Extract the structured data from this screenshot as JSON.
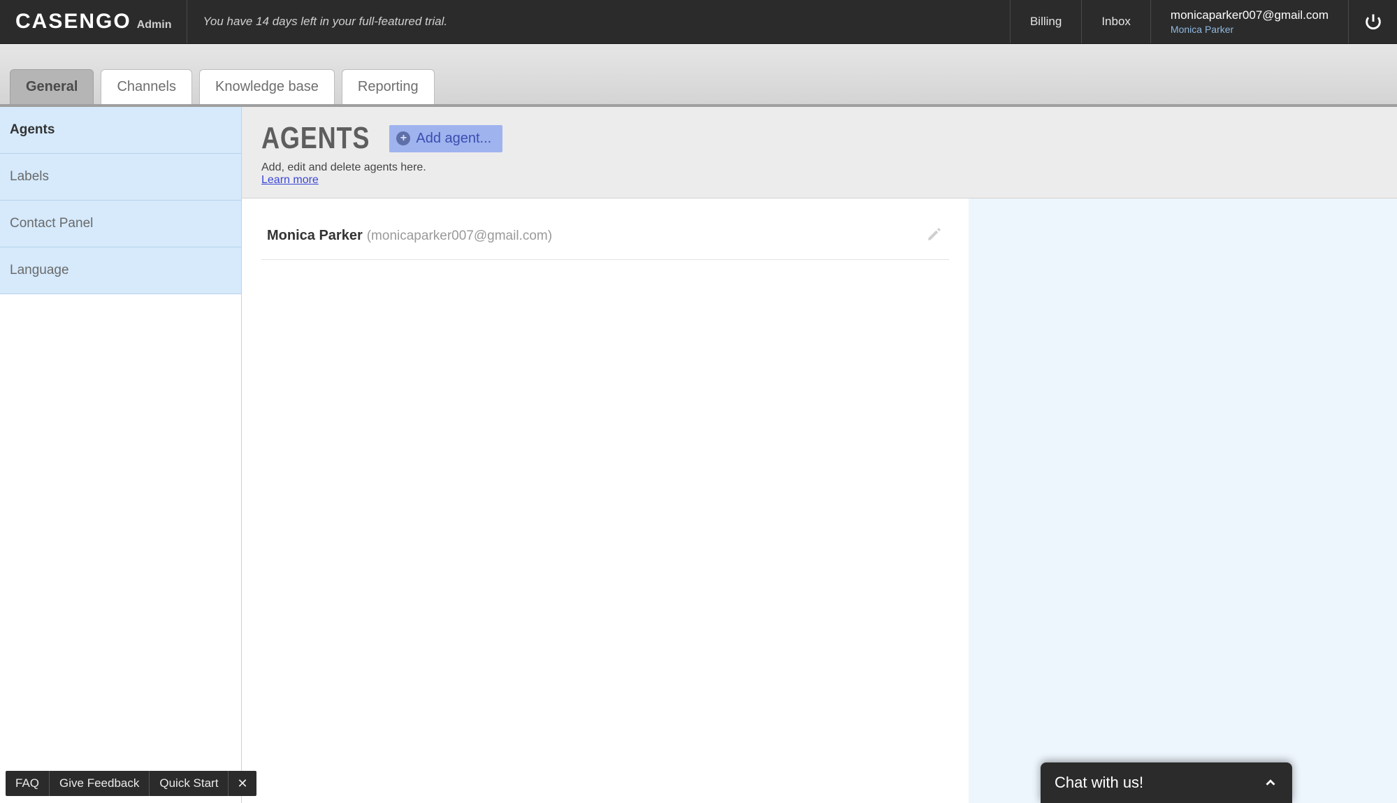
{
  "header": {
    "logo": "CASENGO",
    "logo_sub": "Admin",
    "trial_message": "You have 14 days left in your full-featured trial.",
    "links": {
      "billing": "Billing",
      "inbox": "Inbox"
    },
    "user": {
      "email": "monicaparker007@gmail.com",
      "name": "Monica Parker"
    }
  },
  "tabs": [
    {
      "label": "General",
      "active": true
    },
    {
      "label": "Channels",
      "active": false
    },
    {
      "label": "Knowledge base",
      "active": false
    },
    {
      "label": "Reporting",
      "active": false
    }
  ],
  "sidebar": {
    "items": [
      {
        "label": "Agents",
        "active": true
      },
      {
        "label": "Labels",
        "active": false
      },
      {
        "label": "Contact Panel",
        "active": false
      },
      {
        "label": "Language",
        "active": false
      }
    ]
  },
  "page": {
    "title": "AGENTS",
    "add_button": "Add agent...",
    "subtitle": "Add, edit and delete agents here.",
    "learn_more": "Learn more"
  },
  "agents": [
    {
      "name": "Monica Parker",
      "email": "(monicaparker007@gmail.com)"
    }
  ],
  "bottombar": {
    "items": [
      "FAQ",
      "Give Feedback",
      "Quick Start"
    ],
    "close": "✕"
  },
  "chat": {
    "label": "Chat with us!"
  }
}
